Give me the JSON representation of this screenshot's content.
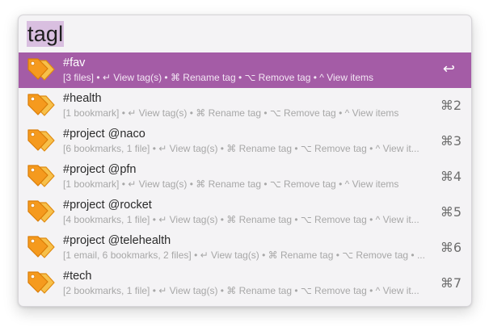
{
  "search": {
    "query": "tagl"
  },
  "results": [
    {
      "title": "#fav",
      "subtitle": "[3 files] • ↵ View tag(s) • ⌘ Rename tag • ⌥ Remove tag • ^ View items",
      "shortcut": "↩"
    },
    {
      "title": "#health",
      "subtitle": "[1 bookmark] • ↵ View tag(s) • ⌘ Rename tag • ⌥ Remove tag • ^ View items",
      "shortcut": "⌘2"
    },
    {
      "title": "#project @naco",
      "subtitle": "[6 bookmarks, 1 file] • ↵ View tag(s) • ⌘ Rename tag • ⌥ Remove tag • ^ View it...",
      "shortcut": "⌘3"
    },
    {
      "title": "#project @pfn",
      "subtitle": "[1 bookmark] • ↵ View tag(s) • ⌘ Rename tag • ⌥ Remove tag • ^ View items",
      "shortcut": "⌘4"
    },
    {
      "title": "#project @rocket",
      "subtitle": "[4 bookmarks, 1 file] • ↵ View tag(s) • ⌘ Rename tag • ⌥ Remove tag • ^ View it...",
      "shortcut": "⌘5"
    },
    {
      "title": "#project @telehealth",
      "subtitle": "[1 email, 6 bookmarks, 2 files] • ↵ View tag(s) • ⌘ Rename tag • ⌥ Remove tag • ...",
      "shortcut": "⌘6"
    },
    {
      "title": "#tech",
      "subtitle": "[2 bookmarks, 1 file] • ↵ View tag(s) • ⌘ Rename tag • ⌥ Remove tag • ^ View it...",
      "shortcut": "⌘7"
    }
  ],
  "icons": {
    "result_icon": "tag-icon"
  },
  "colors": {
    "selection": "#a45ca6",
    "query_highlight": "#d9bfe0",
    "tag_orange": "#f59a1e"
  }
}
